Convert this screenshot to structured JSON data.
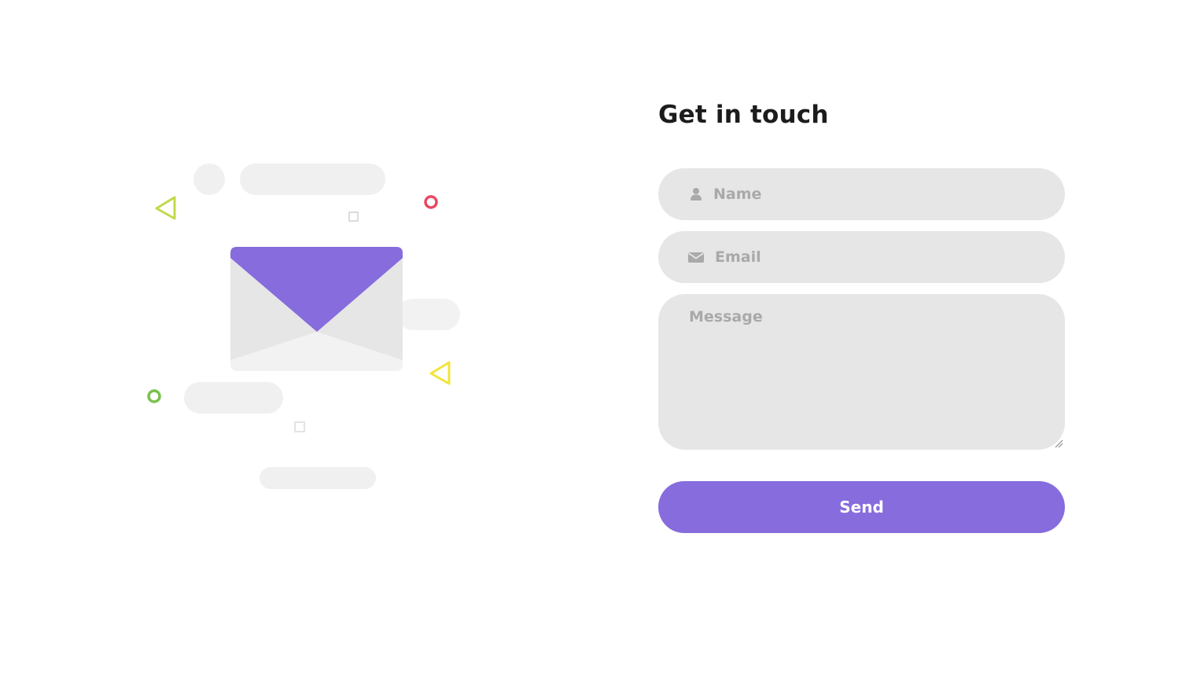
{
  "form": {
    "title": "Get in touch",
    "name_placeholder": "Name",
    "email_placeholder": "Email",
    "message_placeholder": "Message",
    "send_label": "Send",
    "accent_color": "#866cdd",
    "field_background": "#e6e6e6"
  },
  "icons": {
    "name_field_icon": "user-icon",
    "email_field_icon": "envelope-icon"
  },
  "illustration": {
    "envelope_flap_color": "#866cdd",
    "decor_colors": [
      "#c2d94a",
      "#e94860",
      "#f2e43a",
      "#78c24a"
    ]
  }
}
